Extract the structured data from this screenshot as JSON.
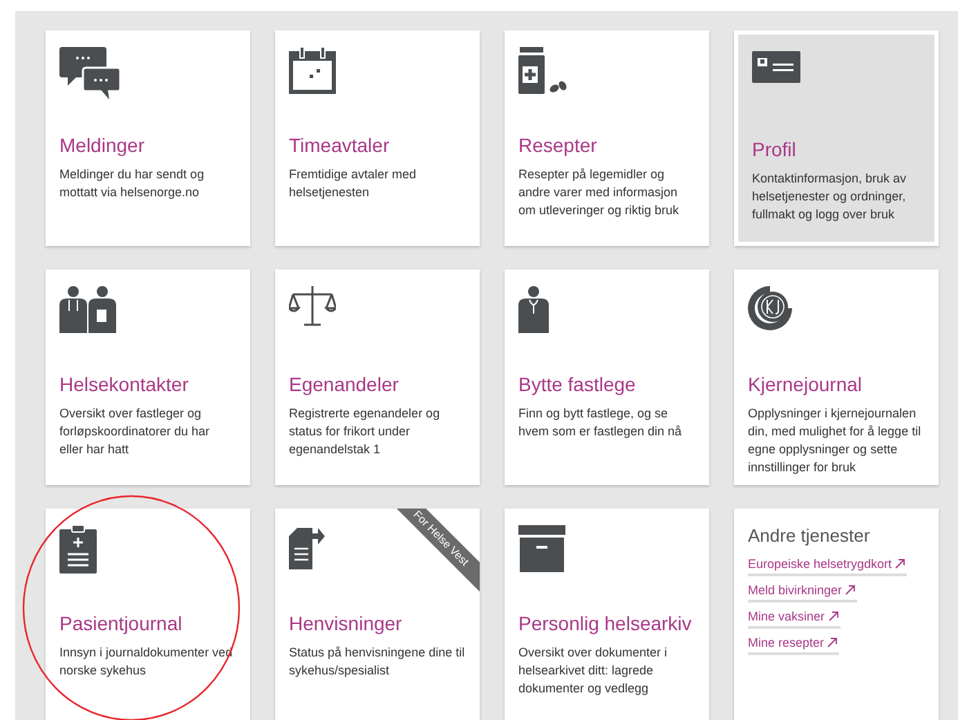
{
  "tiles": [
    {
      "kind": "service",
      "title": "Meldinger",
      "description": "Meldinger du har sendt og mottatt via helsenorge.no",
      "selected": false
    },
    {
      "kind": "service",
      "title": "Timeavtaler",
      "description": "Fremtidige avtaler med helsetjenesten",
      "selected": false
    },
    {
      "kind": "service",
      "title": "Resepter",
      "description": "Resepter på legemidler og andre varer med informasjon om utleveringer og riktig bruk",
      "selected": false
    },
    {
      "kind": "service",
      "title": "Profil",
      "description": "Kontaktinformasjon, bruk av helsetjenester og ordninger, fullmakt og logg over bruk",
      "selected": true
    },
    {
      "kind": "service",
      "title": "Helsekontakter",
      "description": "Oversikt over fastleger og forløpskoordinatorer du har eller har hatt",
      "selected": false
    },
    {
      "kind": "service",
      "title": "Egenandeler",
      "description": "Registrerte egenandeler og status for frikort under egenandelstak 1",
      "selected": false
    },
    {
      "kind": "service",
      "title": "Bytte fastlege",
      "description": "Finn og bytt fastlege, og se hvem som er fastlegen din nå",
      "selected": false
    },
    {
      "kind": "service",
      "title": "Kjernejournal",
      "description": "Opplysninger i kjernejournalen din, med mulighet for å legge til egne opplysninger og sette innstillinger for bruk",
      "selected": false
    },
    {
      "kind": "service",
      "title": "Pasientjournal",
      "description": "Innsyn i journaldokumenter ved norske sykehus",
      "selected": false
    },
    {
      "kind": "service",
      "title": "Henvisninger",
      "description": "Status på henvisningene dine til sykehus/spesialist",
      "selected": false,
      "ribbon": "For Helse Vest"
    },
    {
      "kind": "service",
      "title": "Personlig helsearkiv",
      "description": "Oversikt over dokumenter i helsearkivet ditt: lagrede dokumenter og vedlegg",
      "selected": false
    },
    {
      "kind": "links",
      "title": "Andre tjenester",
      "links": [
        "Europeiske helsetrygdkort",
        "Meld bivirkninger",
        "Mine vaksiner",
        "Mine resepter"
      ]
    }
  ]
}
